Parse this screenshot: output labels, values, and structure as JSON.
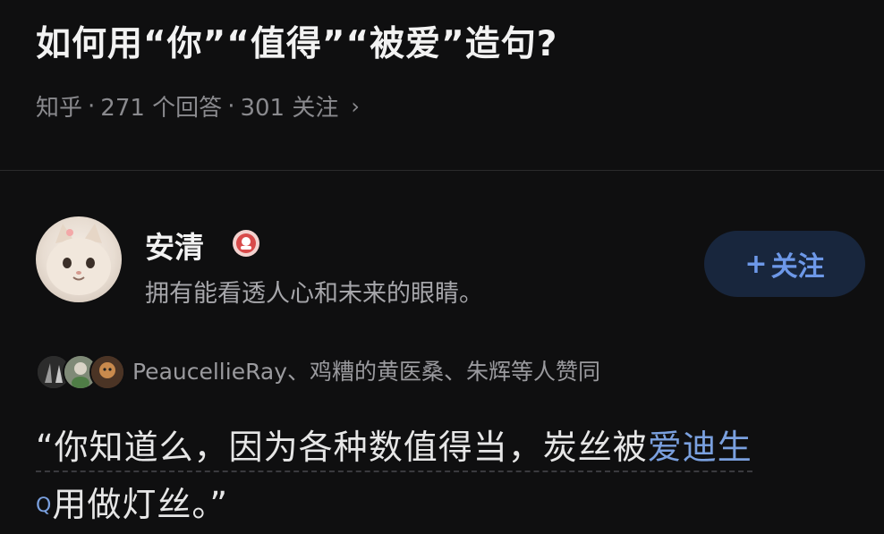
{
  "question": {
    "title": "如何用“你”“值得”“被爱”造句?",
    "meta": {
      "source": "知乎",
      "separator": "·",
      "answers": "271 个回答",
      "followers": "301 关注",
      "chevron": "›"
    }
  },
  "answer": {
    "author": {
      "name": "安清",
      "bio": "拥有能看透人心和未来的眼睛。",
      "avatar_icon": "cat-avatar-icon",
      "badge_icon": "creator-badge-icon"
    },
    "follow_button": {
      "plus": "+",
      "label": "关注"
    },
    "voters_text": "PeaucellieRay、鸡糟的黄医桑、朱辉等人赞同",
    "content": {
      "line1_plain": "“你知道么，因为各种数值得当，炭丝被",
      "line1_link": "爱迪生",
      "search_mark": "Q",
      "line2": "用做灯丝。”"
    }
  },
  "colors": {
    "background": "#0f0f10",
    "accent": "#6d98e8",
    "link": "#7aa0df",
    "follow_bg": "#18263d",
    "badge": "#d84a4a"
  }
}
